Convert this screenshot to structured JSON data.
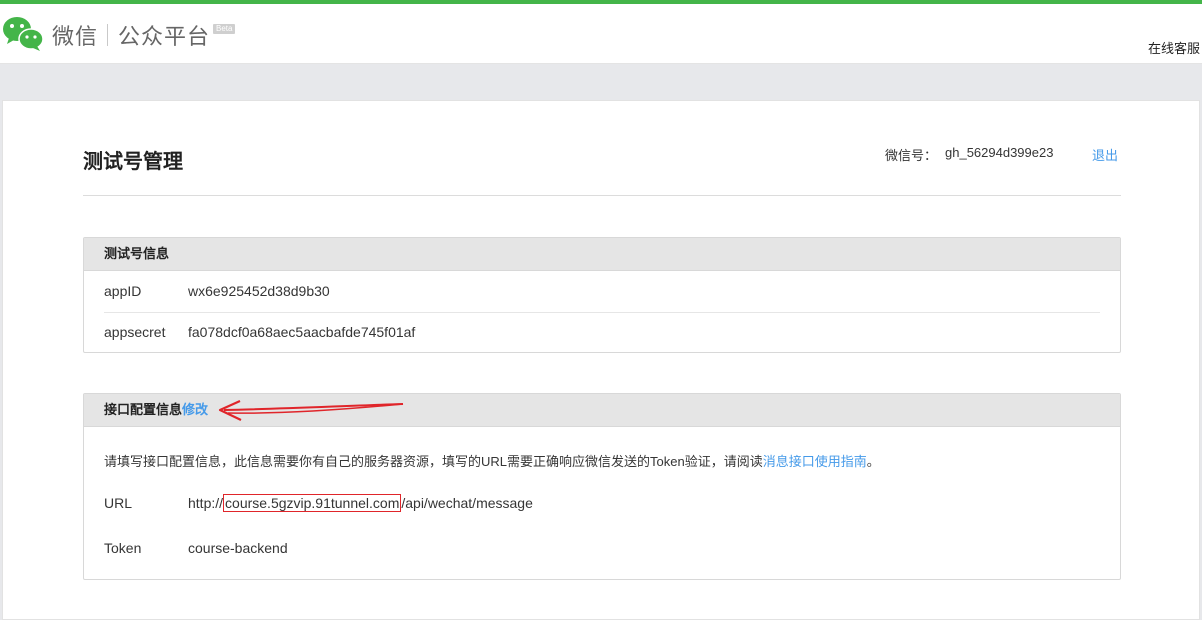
{
  "header": {
    "brand_wechat": "微信",
    "brand_platform": "公众平台",
    "beta_badge": "Beta",
    "service_link": "在线客服"
  },
  "page": {
    "title": "测试号管理",
    "account_label": "微信号：",
    "account_value": "gh_56294d399e23",
    "logout_label": "退出"
  },
  "test_account_card": {
    "title": "测试号信息",
    "rows": [
      {
        "label": "appID",
        "value": "wx6e925452d38d9b30"
      },
      {
        "label": "appsecret",
        "value": "fa078dcf0a68aec5aacbafde745f01af"
      }
    ]
  },
  "interface_card": {
    "title": "接口配置信息",
    "edit_label": "修改",
    "description_prefix": "请填写接口配置信息，此信息需要你有自己的服务器资源，填写的URL需要正确响应微信发送的Token验证，请阅读",
    "description_link": "消息接口使用指南",
    "description_suffix": "。",
    "url_label": "URL",
    "url_prefix": "http://",
    "url_host": "course.5gzvip.91tunnel.com",
    "url_path": "/api/wechat/message",
    "token_label": "Token",
    "token_value": "course-backend"
  },
  "colors": {
    "brand_green": "#44b549",
    "link_blue": "#459ae9",
    "annotation_red": "#e0252a"
  },
  "icons": {
    "logo": "wechat-logo-icon",
    "annotation_arrow": "red-arrow-annotation"
  }
}
